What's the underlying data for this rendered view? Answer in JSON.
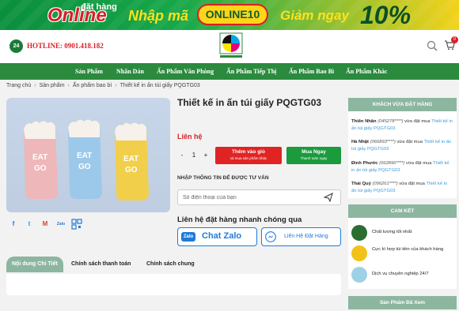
{
  "promo": {
    "dat_hang": "đặt hàng",
    "online": "Online",
    "nhap_ma": "Nhập mã",
    "code": "ONLINE10",
    "giam_ngay": "Giảm ngay",
    "percent": "10%"
  },
  "header": {
    "hotline": "HOTLINE: 0901.418.182",
    "cart_count": "0"
  },
  "nav": {
    "items": [
      "Sản Phẩm",
      "Nhãn Dán",
      "Ấn Phẩm Văn Phòng",
      "Ấn Phẩm Tiếp Thị",
      "Ấn Phẩm Bao Bì",
      "Ấn Phẩm Khác"
    ]
  },
  "breadcrumb": [
    "Trang chủ",
    "Sản phẩm",
    "Ấn phẩm bao bì",
    "Thiết kế in ấn túi giấy PQGTG03"
  ],
  "product": {
    "title": "Thiết kế in ấn túi giấy PQGTG03",
    "price": "Liên hệ",
    "qty_minus": "-",
    "qty_value": "1",
    "qty_plus": "+",
    "add_to_cart": "Thêm vào giỏ",
    "add_to_cart_sub": "và mua sản phẩm khác",
    "buy_now": "Mua Ngay",
    "buy_now_sub": "Thanh toán ngay",
    "consult_label": "NHẬP THÔNG TIN ĐỂ ĐƯỢC TƯ VẤN",
    "phone_placeholder": "Số điện thoại của bạn",
    "quick_order_title": "Liên hệ đặt hàng nhanh chóng qua",
    "zalo_badge": "Zalo",
    "zalo_label": "Chat Zalo",
    "messenger_label": "Liên Hệ Đặt Hàng",
    "package_text": "EAT GO"
  },
  "tabs": [
    "Nội dung Chi Tiết",
    "Chính sách thanh toán",
    "Chính sách chung"
  ],
  "sidebar": {
    "buyers_title": "KHÁCH VỪA ĐẶT HÀNG",
    "buyers": [
      {
        "name": "Thiên Nhân",
        "phone": "(045278****)",
        "action": " vừa đặt mua ",
        "product": "Thiết kế in ấn túi giấy PQGTG03"
      },
      {
        "name": "Hà Nhật",
        "phone": "(066893****)",
        "action": " vừa đặt mua ",
        "product": "Thiết kế in ấn túi giấy PQGTG03"
      },
      {
        "name": "Đình Phước",
        "phone": "(062896****)",
        "action": " vừa đặt mua ",
        "product": "Thiết kế in ấn túi giấy PQGTG03"
      },
      {
        "name": "Thái Quý",
        "phone": "(096261****)",
        "action": " vừa đặt mua ",
        "product": "Thiết kế in ấn túi giấy PQGTG03"
      }
    ],
    "commit_title": "CAM KẾT",
    "commits": [
      "Chất lượng tốt nhất",
      "Cực kì hợp túi tiền của khách hàng",
      "Dịch vụ chuyên nghiệp 24/7"
    ],
    "viewed_title": "Sản Phẩm Đã Xem"
  },
  "colors": {
    "brand_green": "#2b8a3e",
    "accent_red": "#e02424",
    "panel_green": "#8db6a0",
    "link_blue": "#3a9ad9",
    "zalo_blue": "#1f7bd8"
  }
}
